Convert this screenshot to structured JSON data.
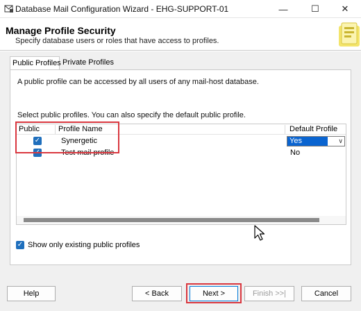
{
  "window": {
    "title": "Database Mail Configuration Wizard - EHG-SUPPORT-01",
    "controls": {
      "minimize": "—",
      "maximize": "☐",
      "close": "✕"
    }
  },
  "header": {
    "title": "Manage Profile Security",
    "subtitle": "Specify database users or roles that have access to profiles."
  },
  "tabs": [
    {
      "label": "Public Profiles",
      "active": true
    },
    {
      "label": "Private Profiles",
      "active": false
    }
  ],
  "panel": {
    "description": "A public profile can be accessed by all users of any mail-host database.",
    "select_label": "Select public profiles. You can also specify the default public profile.",
    "grid": {
      "columns": [
        "Public",
        "Profile Name",
        "Default Profile"
      ],
      "rows": [
        {
          "public": true,
          "profile_name": "Synergetic",
          "default_profile": "Yes",
          "editing": true
        },
        {
          "public": true,
          "profile_name": "Test mail profile",
          "default_profile": "No",
          "editing": false
        }
      ]
    },
    "show_only": {
      "label": "Show only existing public profiles",
      "checked": true
    }
  },
  "buttons": {
    "help": "Help",
    "back": "< Back",
    "next": "Next >",
    "finish": "Finish >>|",
    "cancel": "Cancel"
  },
  "icons": {
    "app": "database-mail-icon",
    "header_art": "wizard-art-icon",
    "checkbox": "checkmark-icon",
    "dropdown": "chevron-down-icon"
  },
  "colors": {
    "highlight": "#d9363e",
    "accent": "#1f6fbd",
    "selection": "#0a64d0"
  }
}
